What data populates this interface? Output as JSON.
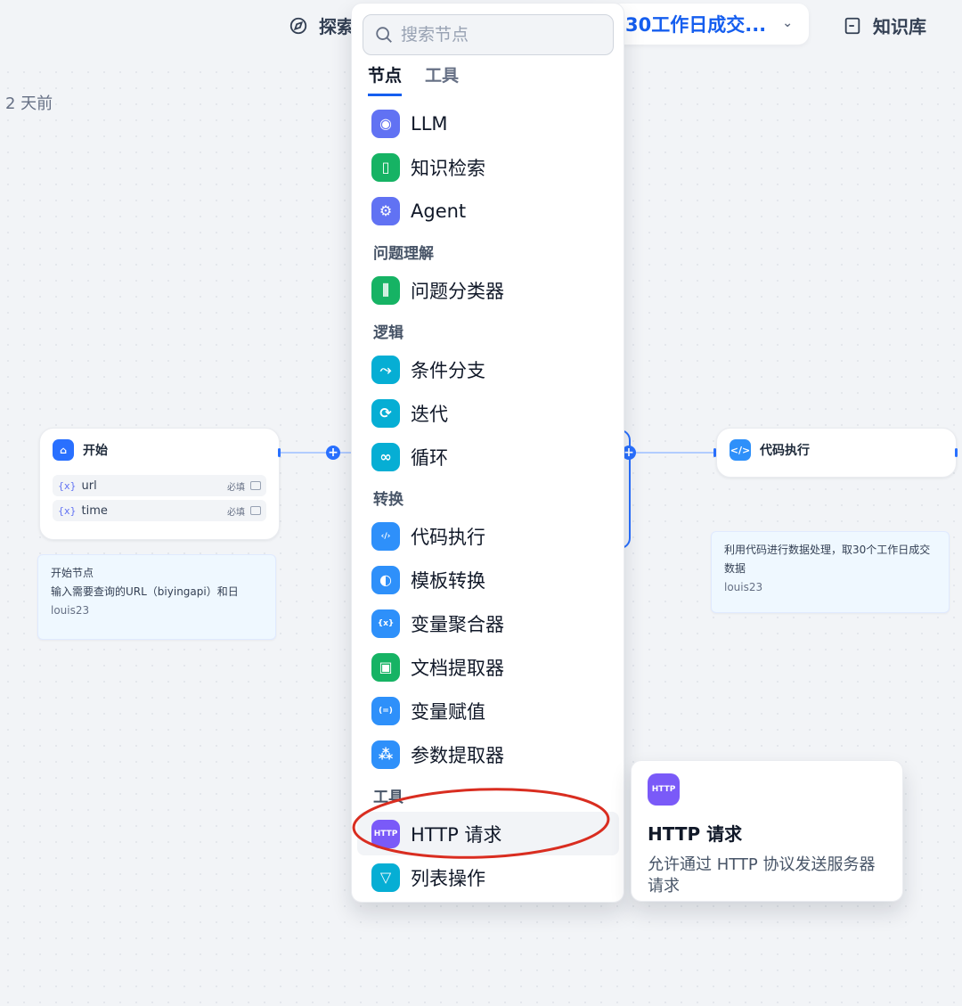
{
  "topbar": {
    "explore_label": "探索",
    "app_name": "30工作日成交...",
    "knowledge_label": "知识库"
  },
  "time_ago": "2 天前",
  "nodes": {
    "start": {
      "title": "开始",
      "vars": [
        {
          "name": "url",
          "required": "必填"
        },
        {
          "name": "time",
          "required": "必填"
        }
      ],
      "note_title": "开始节点",
      "note_body": "输入需要查询的URL（biyingapi）和日",
      "note_author": "louis23"
    },
    "code": {
      "title": "代码执行",
      "note_body": "利用代码进行数据处理，取30个工作日成交数据",
      "note_author": "louis23"
    }
  },
  "panel": {
    "search_placeholder": "搜索节点",
    "tabs": [
      {
        "label": "节点",
        "active": true
      },
      {
        "label": "工具",
        "active": false
      }
    ],
    "items": [
      {
        "type": "item",
        "label": "LLM",
        "icon": "brain-icon",
        "color": "#6172f3"
      },
      {
        "type": "item",
        "label": "知识检索",
        "icon": "book-icon",
        "color": "#16b364"
      },
      {
        "type": "item",
        "label": "Agent",
        "icon": "agent-icon",
        "color": "#6172f3"
      },
      {
        "type": "group",
        "label": "问题理解"
      },
      {
        "type": "item",
        "label": "问题分类器",
        "icon": "classifier-icon",
        "color": "#16b364"
      },
      {
        "type": "group",
        "label": "逻辑"
      },
      {
        "type": "item",
        "label": "条件分支",
        "icon": "branch-icon",
        "color": "#06aed4"
      },
      {
        "type": "item",
        "label": "迭代",
        "icon": "iterate-icon",
        "color": "#06aed4"
      },
      {
        "type": "item",
        "label": "循环",
        "icon": "loop-icon",
        "color": "#06aed4"
      },
      {
        "type": "group",
        "label": "转换"
      },
      {
        "type": "item",
        "label": "代码执行",
        "icon": "code-icon",
        "color": "#2e90fa"
      },
      {
        "type": "item",
        "label": "模板转换",
        "icon": "template-icon",
        "color": "#2e90fa"
      },
      {
        "type": "item",
        "label": "变量聚合器",
        "icon": "variable-aggregator-icon",
        "color": "#2e90fa"
      },
      {
        "type": "item",
        "label": "文档提取器",
        "icon": "doc-extractor-icon",
        "color": "#16b364"
      },
      {
        "type": "item",
        "label": "变量赋值",
        "icon": "assign-icon",
        "color": "#2e90fa"
      },
      {
        "type": "item",
        "label": "参数提取器",
        "icon": "param-extractor-icon",
        "color": "#2e90fa"
      },
      {
        "type": "group",
        "label": "工具"
      },
      {
        "type": "item",
        "label": "HTTP 请求",
        "icon": "http-icon",
        "color": "#7a5af8",
        "highlighted": true
      },
      {
        "type": "item",
        "label": "列表操作",
        "icon": "filter-icon",
        "color": "#06aed4"
      }
    ]
  },
  "tooltip": {
    "icon_text": "HTTP",
    "title": "HTTP 请求",
    "description": "允许通过 HTTP 协议发送服务器请求"
  },
  "colors": {
    "accent": "#155eef",
    "annotation": "#d92d20"
  }
}
